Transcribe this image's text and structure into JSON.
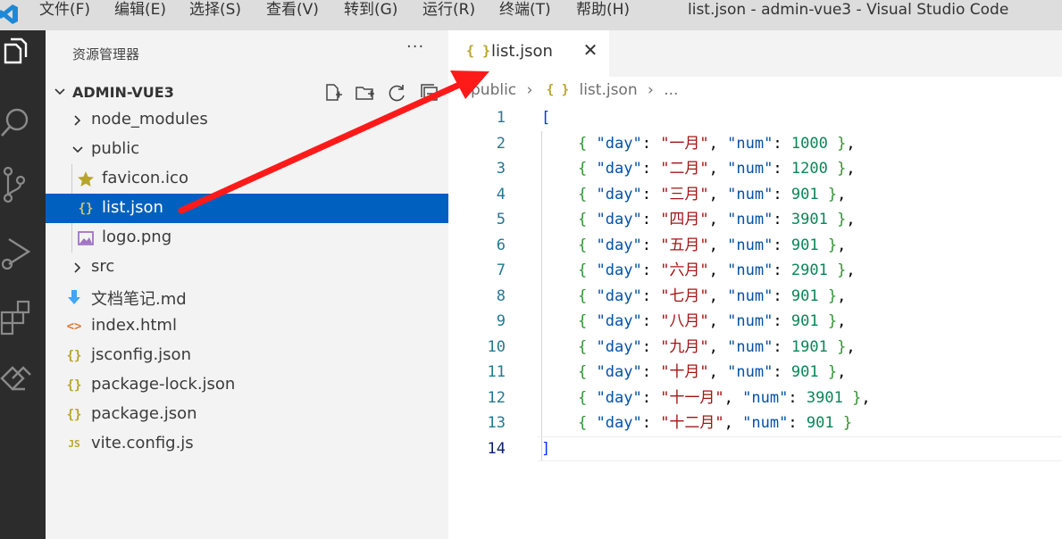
{
  "titlebar": {
    "menu": [
      "文件(F)",
      "编辑(E)",
      "选择(S)",
      "查看(V)",
      "转到(G)",
      "运行(R)",
      "终端(T)",
      "帮助(H)"
    ],
    "window_title": "list.json - admin-vue3 - Visual Studio Code"
  },
  "activity_bar": {
    "icons": [
      "explorer-icon",
      "search-icon",
      "source-control-icon",
      "run-debug-icon",
      "extensions-icon",
      "remote-icon"
    ]
  },
  "explorer": {
    "title": "资源管理器",
    "more": "···",
    "folder": "ADMIN-VUE3",
    "items": [
      {
        "label": "node_modules",
        "type": "folder",
        "expanded": false
      },
      {
        "label": "public",
        "type": "folder",
        "expanded": true
      },
      {
        "label": "favicon.ico",
        "type": "file",
        "icon": "star-icon",
        "icon_color": "#b8a42b"
      },
      {
        "label": "list.json",
        "type": "file",
        "icon": "json-icon",
        "icon_color": "#cfc372",
        "selected": true
      },
      {
        "label": "logo.png",
        "type": "file",
        "icon": "image-icon",
        "icon_color": "#a074c4"
      },
      {
        "label": "src",
        "type": "folder",
        "expanded": false
      },
      {
        "label": "文档笔记.md",
        "type": "file",
        "icon": "markdown-icon",
        "icon_color": "#42a5f5"
      },
      {
        "label": "index.html",
        "type": "file",
        "icon": "html-icon",
        "icon_color": "#e37933"
      },
      {
        "label": "jsconfig.json",
        "type": "file",
        "icon": "json-icon",
        "icon_color": "#b8a42b"
      },
      {
        "label": "package-lock.json",
        "type": "file",
        "icon": "json-icon",
        "icon_color": "#b8a42b"
      },
      {
        "label": "package.json",
        "type": "file",
        "icon": "json-icon",
        "icon_color": "#b8a42b"
      },
      {
        "label": "vite.config.js",
        "type": "file",
        "icon": "js-icon",
        "icon_color": "#b8a42b"
      }
    ]
  },
  "editor": {
    "tab": {
      "icon": "{ }",
      "label": "list.json",
      "close": "✕"
    },
    "breadcrumb": {
      "folder": "public",
      "icon": "{ }",
      "file": "list.json",
      "tail": "..."
    },
    "active_line": 14,
    "lines": [
      "[",
      "    { \"day\": \"一月\", \"num\": 1000 },",
      "    { \"day\": \"二月\", \"num\": 1200 },",
      "    { \"day\": \"三月\", \"num\": 901 },",
      "    { \"day\": \"四月\", \"num\": 3901 },",
      "    { \"day\": \"五月\", \"num\": 901 },",
      "    { \"day\": \"六月\", \"num\": 2901 },",
      "    { \"day\": \"七月\", \"num\": 901 },",
      "    { \"day\": \"八月\", \"num\": 901 },",
      "    { \"day\": \"九月\", \"num\": 1901 },",
      "    { \"day\": \"十月\", \"num\": 901 },",
      "    { \"day\": \"十一月\", \"num\": 3901 },",
      "    { \"day\": \"十二月\", \"num\": 901 }",
      "]"
    ]
  },
  "annotation": {
    "color": "#ff1a1a"
  }
}
